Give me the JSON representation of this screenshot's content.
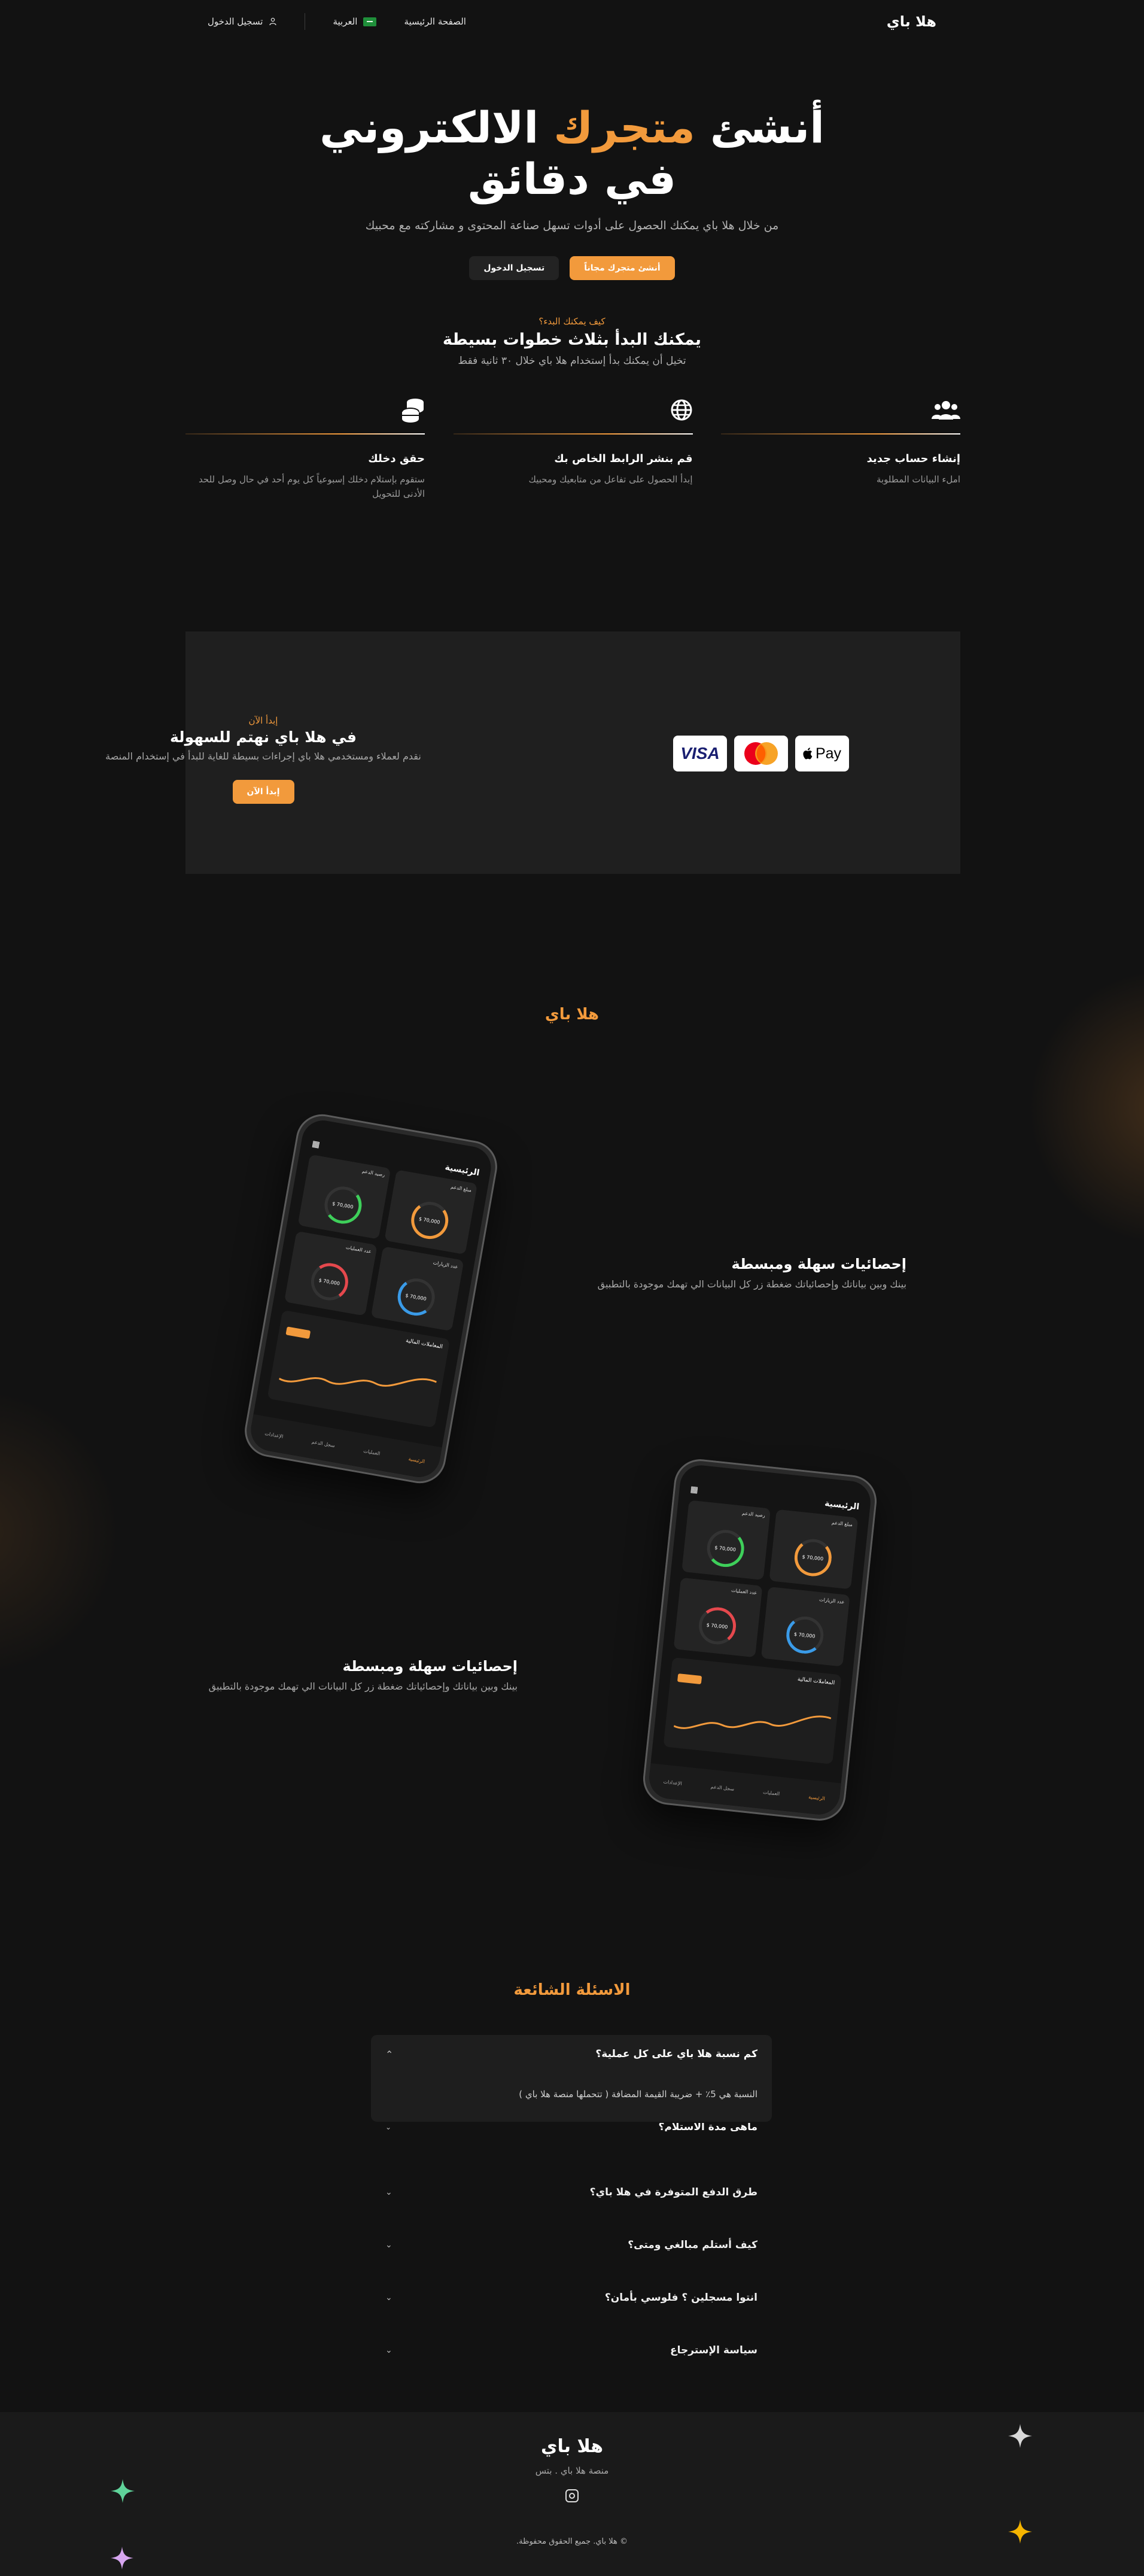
{
  "header": {
    "logo": "هلا باي",
    "nav": {
      "home": "الصفحة الرئيسية",
      "language": "العربية",
      "login": "تسجيل الدخول"
    }
  },
  "hero": {
    "title_line1_prefix": "أنشئ",
    "title_line1_accent": "متجرك",
    "title_line1_suffix": "الالكتروني",
    "title_line2": "في دقائق",
    "subtitle": "من خلال هلا باي يمكنك الحصول على أدوات تسهل صناعة المحتوى و مشاركته مع محبيك",
    "create_store_button": "أنشئ متجرك مجاناً",
    "login_button": "تسجيل الدخول"
  },
  "steps": {
    "eyebrow": "كيف يمكنك البدء؟",
    "title": "يمكنك البدأ بثلاث خطوات بسيطة",
    "subtitle": "تخيل أن يمكنك بدأ إستخدام هلا باي خلال ٣٠ ثانية فقط",
    "items": [
      {
        "icon": "users-icon",
        "title": "إنشاء حساب جديد",
        "desc": "املء البيانات المطلوبة"
      },
      {
        "icon": "globe-icon",
        "title": "قم بنشر الرابط الخاص بك",
        "desc": "إبدأ الحصول على تفاعل من متابعيك ومحبيك"
      },
      {
        "icon": "coins-icon",
        "title": "حقق دخلك",
        "desc": "ستقوم بإستلام دخلك إسبوعياً كل يوم أحد في حال وصل للحد الأدنى للتحويل"
      }
    ]
  },
  "payment": {
    "eyebrow": "إبدأ الآن",
    "title": "في هلا باي نهتم للسهولة",
    "desc": "نقدم لعملاء ومستخدمي هلا باي إجراءات بسيطة للغاية للبدأ في إستخدام المنصة",
    "button": "إبدأ الآن",
    "cards": {
      "visa": "VISA",
      "apple_pay": "Pay"
    }
  },
  "brand_title": "هلا باي",
  "features": [
    {
      "title": "إحصائيات سهلة ومبسطة",
      "desc": "بينك وبين بياناتك وإحصائياتك ضغطة زر كل البيانات الي تهمك موجودة بالتطبيق"
    },
    {
      "title": "إحصائيات سهلة ومبسطة",
      "desc": "بينك وبين بياناتك وإحصائياتك ضغطة زر كل البيانات الي تهمك موجودة بالتطبيق"
    }
  ],
  "phone": {
    "header": "الرئيسية",
    "cards": [
      {
        "label": "مبلغ الدعم",
        "value": "70,000 $",
        "fill": 0.75
      },
      {
        "label": "رصيد الدعم",
        "value": "70,000 $",
        "fill": 0.65
      },
      {
        "label": "عدد الزيارات",
        "value": "70,000 $",
        "fill": 0.55
      },
      {
        "label": "عدد العمليات",
        "value": "70,000 $",
        "fill": 0.7
      }
    ],
    "chart_title": "المعاملات المالية",
    "nav": [
      "الرئيسية",
      "العمليات",
      "سجل الدعم",
      "الإعدادات"
    ],
    "colors": {
      "orange": "#f29a3c",
      "green": "#3ecf5a",
      "blue": "#3a9be8",
      "red": "#e5484d"
    }
  },
  "faq": {
    "title": "الاسئلة الشائعة",
    "open_item": {
      "question": "كم نسبة هلا باي على كل عملية؟",
      "answer": "النسبة هي 5٪ + ضريبة القيمة المضافة ( تتحملها منصة هلا باي )"
    },
    "clipped_item": "ماهي مدة الاستلام؟",
    "items": [
      "طرق الدفع المتوفرة في هلا باي؟",
      "كيف أستلم مبالغي ومتى؟",
      "انتوا مسجلين ؟ فلوسي بأمان؟",
      "سياسة الإسترجاع"
    ]
  },
  "footer": {
    "brand": "هلا باي",
    "subtitle": "منصة هلا باي . بتس",
    "copyright": "© هلا باي. جميع الحقوق محفوظة."
  },
  "colors": {
    "accent": "#f29a3c",
    "background": "#121212",
    "panel": "#1f1f1f"
  }
}
